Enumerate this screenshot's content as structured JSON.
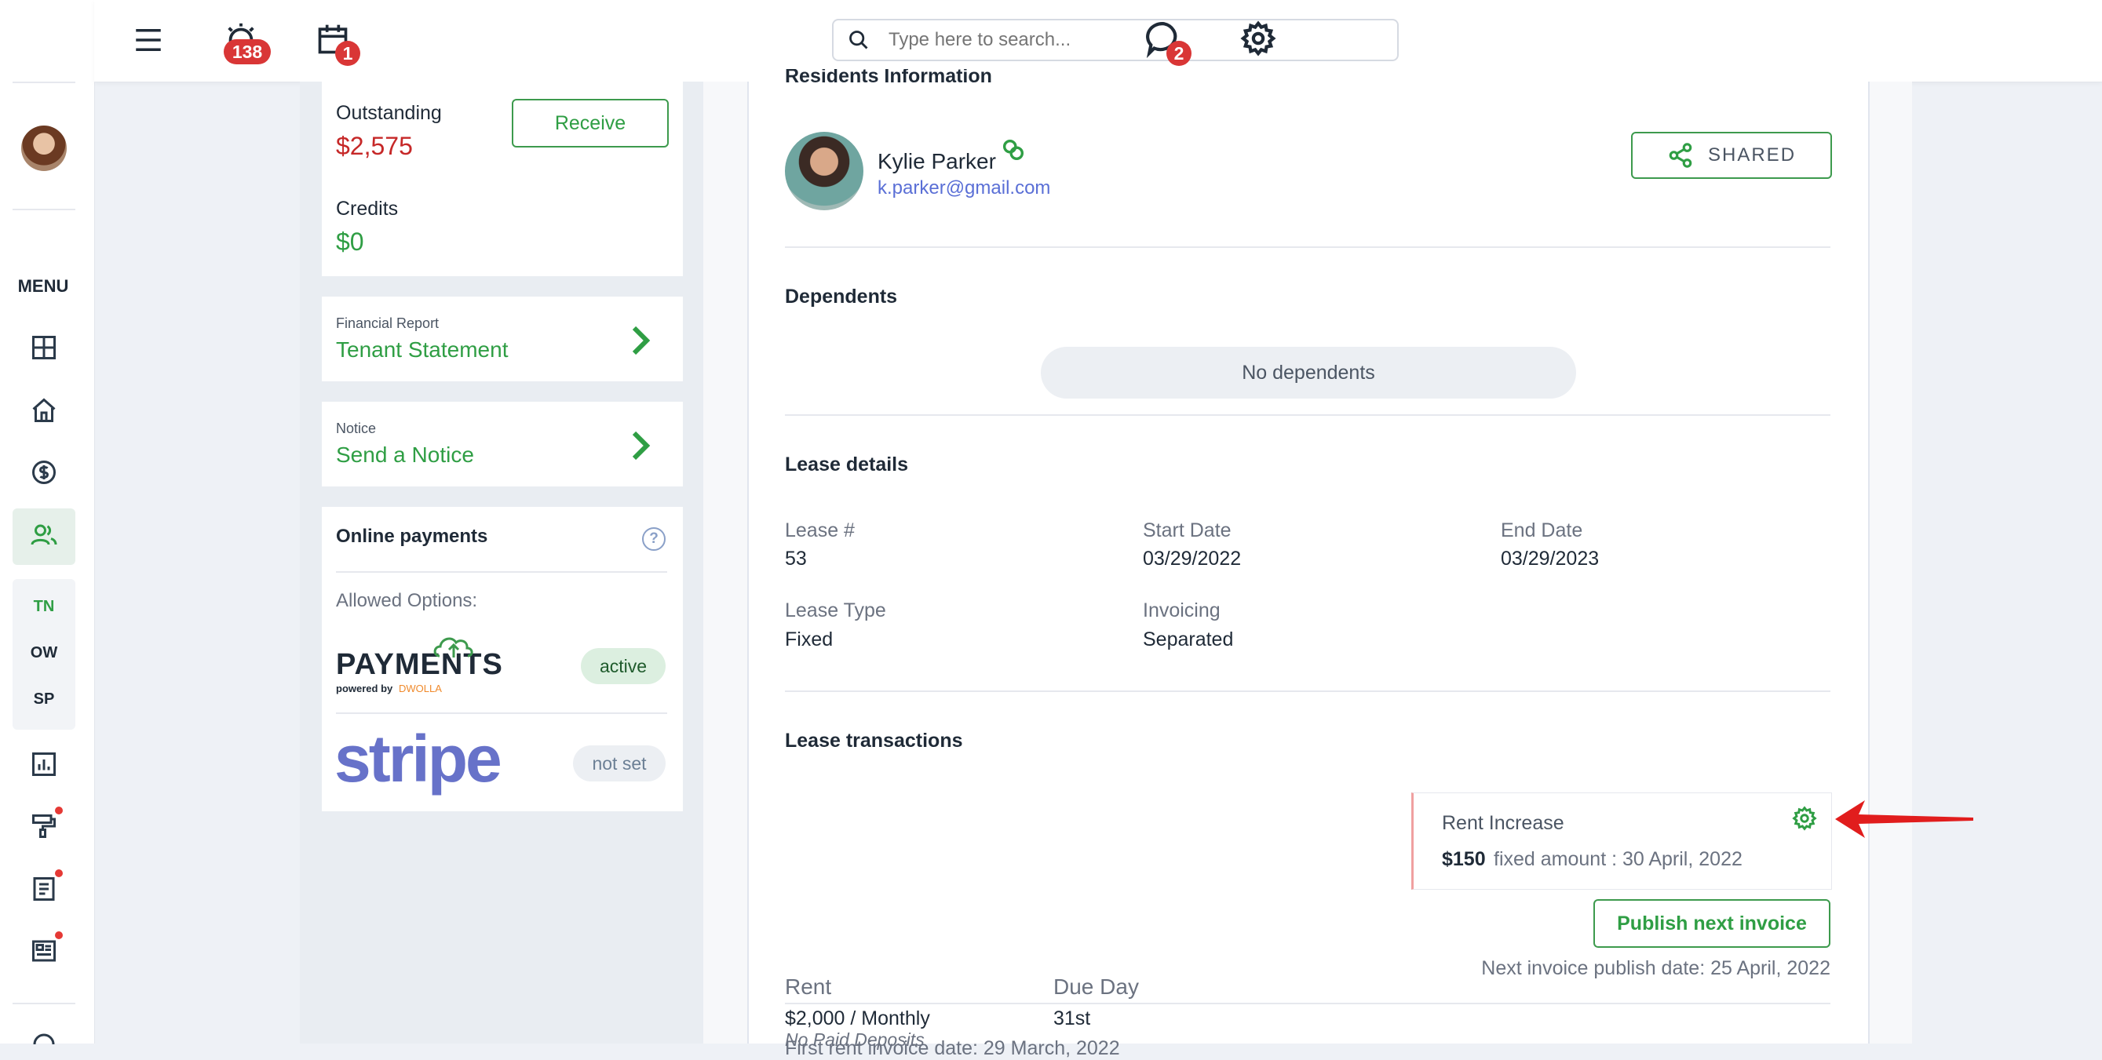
{
  "topbar": {
    "search_placeholder": "Type here to search...",
    "alerts_count": "138",
    "calendar_count": "1",
    "chat_count": "2"
  },
  "sidebar": {
    "menu_label": "MENU",
    "shortcuts": [
      "TN",
      "OW",
      "SP"
    ]
  },
  "balance": {
    "outstanding_label": "Outstanding",
    "outstanding_value": "$2,575",
    "receive_label": "Receive",
    "credits_label": "Credits",
    "credits_value": "$0"
  },
  "links": {
    "report_caption": "Financial Report",
    "report_title": "Tenant Statement",
    "notice_caption": "Notice",
    "notice_title": "Send a Notice"
  },
  "payments": {
    "title": "Online payments",
    "allowed_label": "Allowed Options:",
    "payments_logo": "PAYMENTS",
    "payments_powered": "powered by",
    "payments_partner": "DWOLLA",
    "payments_status": "active",
    "stripe_logo": "stripe",
    "stripe_status": "not set"
  },
  "resident": {
    "section_title": "Residents Information",
    "name": "Kylie Parker",
    "email": "k.parker@gmail.com",
    "shared_label": "SHARED"
  },
  "dependents": {
    "title": "Dependents",
    "empty_text": "No dependents"
  },
  "lease": {
    "title": "Lease details",
    "number_label": "Lease #",
    "number_value": "53",
    "start_label": "Start Date",
    "start_value": "03/29/2022",
    "end_label": "End Date",
    "end_value": "03/29/2023",
    "type_label": "Lease Type",
    "type_value": "Fixed",
    "invoicing_label": "Invoicing",
    "invoicing_value": "Separated"
  },
  "transactions": {
    "title": "Lease transactions",
    "increase_title": "Rent Increase",
    "increase_amount": "$150",
    "increase_detail": "fixed amount : 30 April, 2022",
    "rent_label": "Rent",
    "rent_value": "$2,000 / Monthly",
    "due_label": "Due Day",
    "due_value": "31st",
    "first_invoice": "First rent invoice date: 29 March, 2022",
    "publish_label": "Publish next invoice",
    "next_publish": "Next invoice publish date: 25 April, 2022",
    "deposits_text": "No Paid Deposits"
  },
  "colors": {
    "accent_green": "#2f9e44",
    "alert_red": "#d93636",
    "link_blue": "#5a6fd6"
  }
}
